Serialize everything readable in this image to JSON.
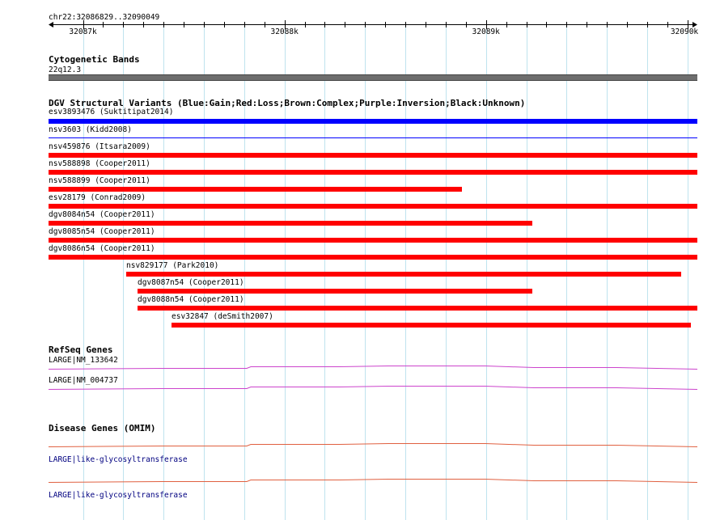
{
  "ruler": {
    "location": "chr22:32086829..32090049",
    "ticks": [
      {
        "label": "32087k",
        "pos": 32087000
      },
      {
        "label": "32088k",
        "pos": 32088000
      },
      {
        "label": "32089k",
        "pos": 32089000
      },
      {
        "label": "32090k",
        "pos": 32090000
      }
    ]
  },
  "cytoband": {
    "title": "Cytogenetic Bands",
    "band": "22q12.3"
  },
  "dgv": {
    "title": "DGV Structural Variants (Blue:Gain;Red:Loss;Brown:Complex;Purple:Inversion;Black:Unknown)",
    "colors": {
      "gain": "#0000ff",
      "loss": "#ff0000"
    },
    "variants": [
      {
        "label": "esv3893476 (Suktitipat2014)",
        "type": "gain"
      },
      {
        "label": "nsv3603 (Kidd2008)",
        "type": "gain"
      },
      {
        "label": "nsv459876 (Itsara2009)",
        "type": "loss"
      },
      {
        "label": "nsv588898 (Cooper2011)",
        "type": "loss"
      },
      {
        "label": "nsv588899 (Cooper2011)",
        "type": "loss"
      },
      {
        "label": "esv28179 (Conrad2009)",
        "type": "loss"
      },
      {
        "label": "dgv8084n54 (Cooper2011)",
        "type": "loss"
      },
      {
        "label": "dgv8085n54 (Cooper2011)",
        "type": "loss"
      },
      {
        "label": "dgv8086n54 (Cooper2011)",
        "type": "loss"
      },
      {
        "label": "nsv829177 (Park2010)",
        "type": "loss"
      },
      {
        "label": "dgv8087n54 (Cooper2011)",
        "type": "loss"
      },
      {
        "label": "dgv8088n54 (Cooper2011)",
        "type": "loss"
      },
      {
        "label": "esv32847 (deSmith2007)",
        "type": "loss"
      }
    ]
  },
  "refseq": {
    "title": "RefSeq Genes",
    "color": "#cc44cc",
    "genes": [
      {
        "label": "LARGE|NM_133642"
      },
      {
        "label": "LARGE|NM_004737"
      }
    ]
  },
  "omim": {
    "title": "Disease Genes (OMIM)",
    "color": "#e06040",
    "genes": [
      {
        "label": "LARGE|like-glycosyltransferase"
      },
      {
        "label": "LARGE|like-glycosyltransferase"
      }
    ]
  }
}
